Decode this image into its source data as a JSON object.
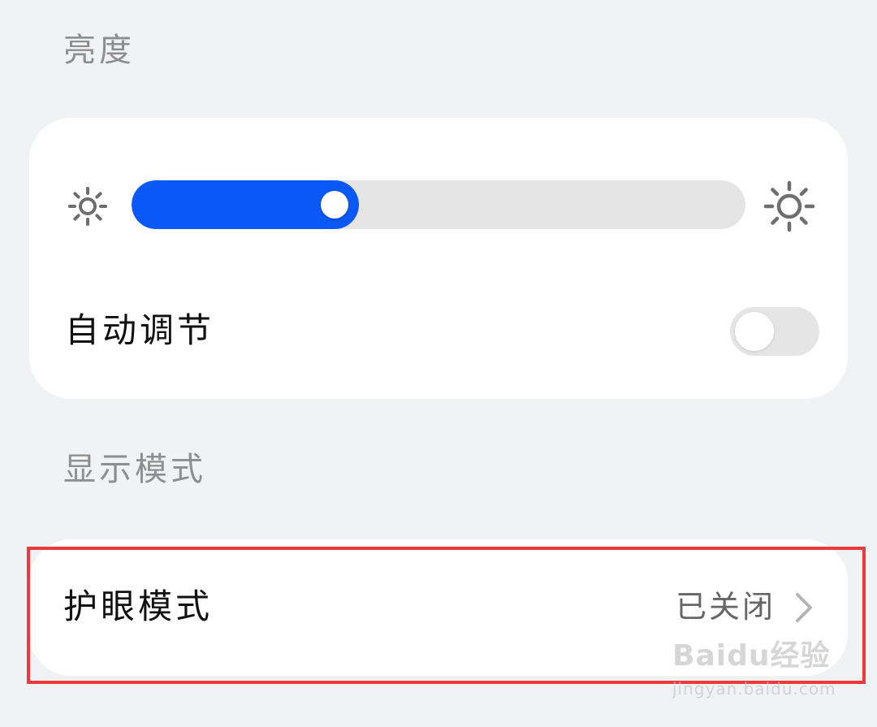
{
  "brightness_section": {
    "title": "亮度",
    "slider_level_percent": 37,
    "auto_adjust_label": "自动调节",
    "auto_adjust_on": false
  },
  "display_section": {
    "title": "显示模式",
    "eye_comfort": {
      "label": "护眼模式",
      "status": "已关闭"
    }
  },
  "icons": {
    "dim": "brightness-low-icon",
    "bright": "brightness-high-icon",
    "chevron": "chevron-right-icon"
  },
  "colors": {
    "accent": "#0a59f7",
    "highlight_border": "#ee3a3c",
    "background": "#f1f2f4"
  },
  "watermark": {
    "brand": "Baidu经验",
    "url": "jingyan.baidu.com"
  }
}
